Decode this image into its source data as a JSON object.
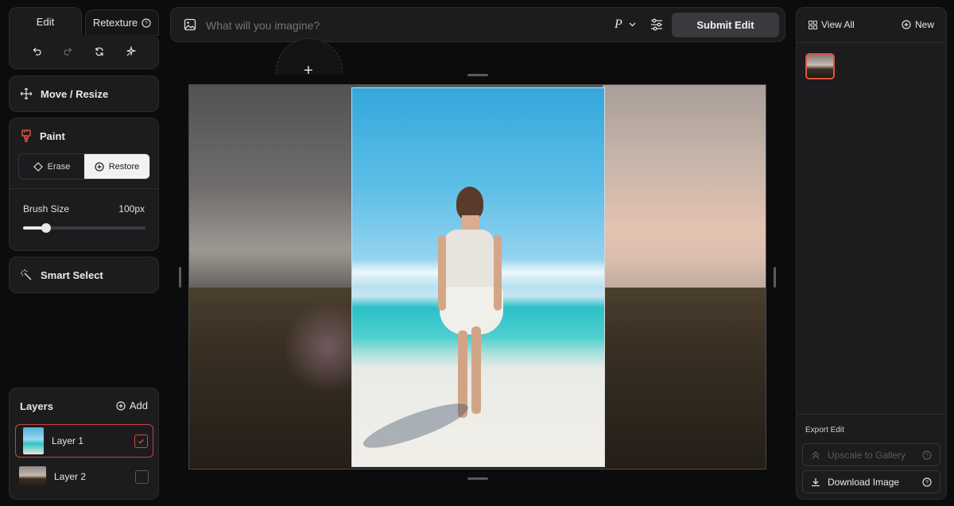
{
  "left": {
    "tabs": {
      "edit": "Edit",
      "retexture": "Retexture"
    },
    "tools": [
      "undo-icon",
      "redo-icon",
      "refresh-icon",
      "sparkle-icon"
    ],
    "move_resize": "Move / Resize",
    "paint": {
      "title": "Paint",
      "erase": "Erase",
      "restore": "Restore",
      "brush_label": "Brush Size",
      "brush_value": "100px",
      "brush_fraction": 0.19
    },
    "smart_select": "Smart Select",
    "layers": {
      "title": "Layers",
      "add": "Add",
      "items": [
        {
          "label": "Layer 1",
          "checked": true
        },
        {
          "label": "Layer 2",
          "checked": false
        }
      ]
    }
  },
  "prompt": {
    "placeholder": "What will you imagine?",
    "model": "P",
    "submit": "Submit Edit"
  },
  "right": {
    "view_all": "View All",
    "new": "New",
    "export_title": "Export Edit",
    "upscale": "Upscale to Gallery",
    "download": "Download Image"
  },
  "colors": {
    "accent": "#d24a3e",
    "panel": "#1c1c1e",
    "bg": "#0c0c0d"
  }
}
